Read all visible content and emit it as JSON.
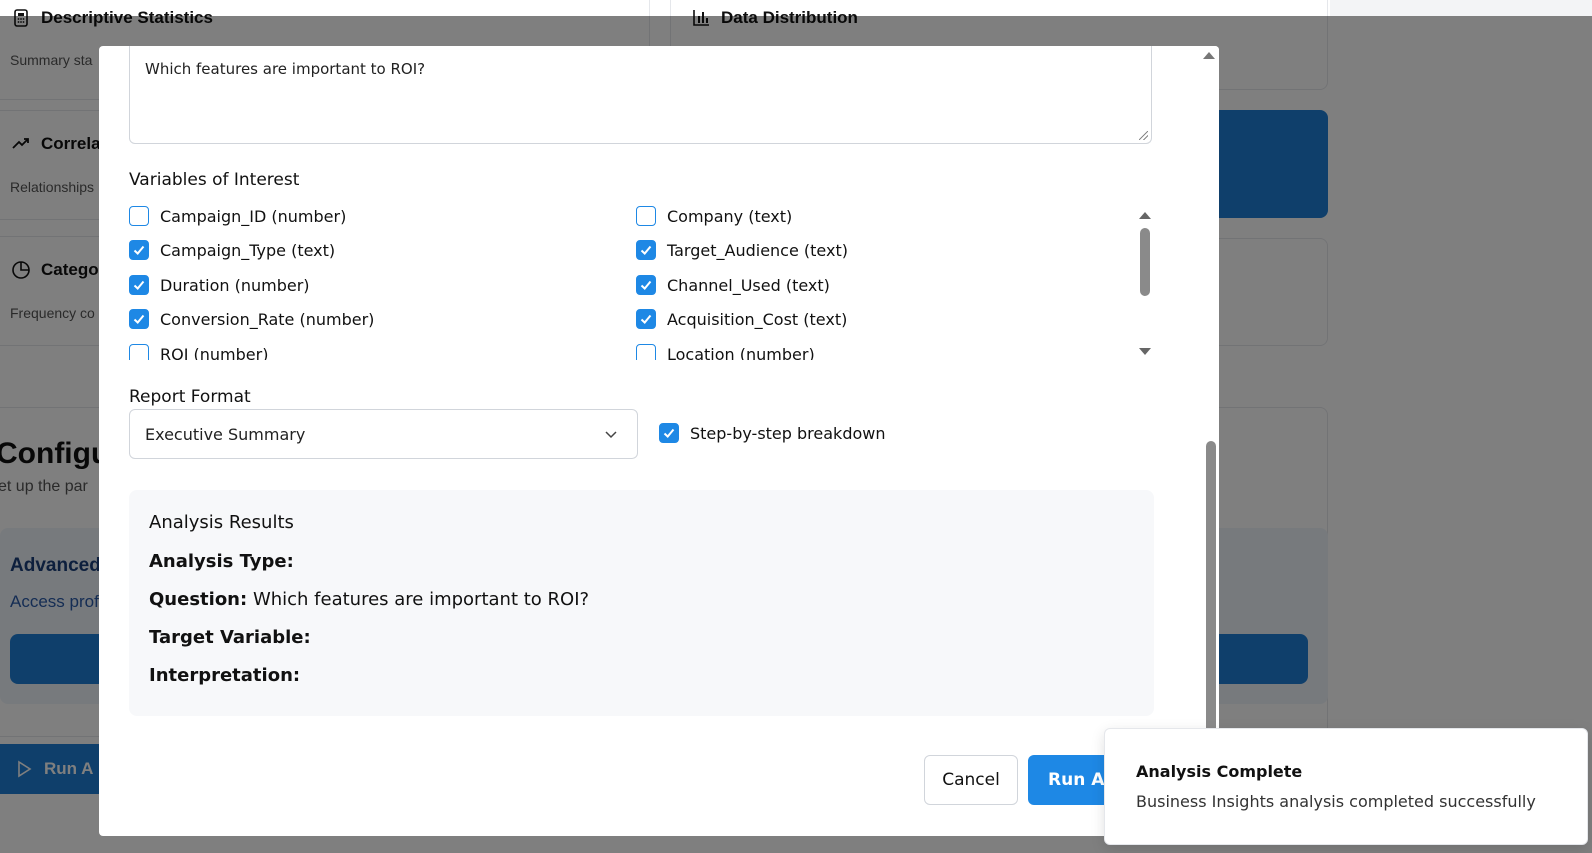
{
  "background": {
    "cards": {
      "descriptive": {
        "title": "Descriptive Statistics",
        "subtitle": "Summary sta"
      },
      "distribution": {
        "title": "Data Distribution"
      },
      "correlation": {
        "title": "Correla",
        "subtitle": "Relationships"
      },
      "categorical": {
        "title": "Categor",
        "subtitle": "Frequency co"
      }
    },
    "config": {
      "title": "Configu",
      "subtitle": "et up the par"
    },
    "advanced": {
      "title": "Advanced",
      "subtitle": "Access prof"
    },
    "run_button_label": "Run A"
  },
  "modal": {
    "question_value": "Which features are important to ROI?",
    "variables_label": "Variables of Interest",
    "variables": [
      {
        "label": "Campaign_ID (number)",
        "checked": false
      },
      {
        "label": "Company (text)",
        "checked": false
      },
      {
        "label": "Campaign_Type (text)",
        "checked": true
      },
      {
        "label": "Target_Audience (text)",
        "checked": true
      },
      {
        "label": "Duration (number)",
        "checked": true
      },
      {
        "label": "Channel_Used (text)",
        "checked": true
      },
      {
        "label": "Conversion_Rate (number)",
        "checked": true
      },
      {
        "label": "Acquisition_Cost (text)",
        "checked": true
      },
      {
        "label": "ROI (number)",
        "checked": false
      },
      {
        "label": "Location (number)",
        "checked": false
      }
    ],
    "report_format_label": "Report Format",
    "report_format_value": "Executive Summary",
    "step_by_step_label": "Step-by-step breakdown",
    "step_by_step_checked": true,
    "results": {
      "title": "Analysis Results",
      "analysis_type_label": "Analysis Type:",
      "analysis_type_value": "",
      "question_label": "Question:",
      "question_value": "Which features are important to ROI?",
      "target_label": "Target Variable:",
      "target_value": "",
      "interpretation_label": "Interpretation:",
      "interpretation_value": ""
    },
    "cancel_label": "Cancel",
    "run_label": "Run Analysis"
  },
  "toast": {
    "title": "Analysis Complete",
    "message": "Business Insights analysis completed successfully"
  },
  "colors": {
    "accent": "#1e88e5",
    "overlay": "rgba(0,0,0,0.5)"
  }
}
